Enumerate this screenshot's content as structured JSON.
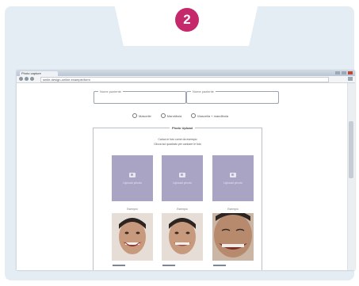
{
  "step": {
    "number": "2"
  },
  "browser": {
    "tab_title": "Photo capture",
    "url": "smile-design-online.example/form"
  },
  "form": {
    "field_left_label": "Nome paziente",
    "field_right_label": "Nome paziente",
    "radios": [
      {
        "label": "Mascelle"
      },
      {
        "label": "Mandibola"
      },
      {
        "label": "Mascella + mandibola"
      }
    ]
  },
  "panel": {
    "legend": "Photo Upload",
    "instruction_1": "Carica le foto come da esempio",
    "instruction_2": "Clicca sul quadrato per caricare le foto"
  },
  "slots": [
    {
      "placeholder": "Upload photo",
      "caption": "Esempio"
    },
    {
      "placeholder": "Upload photo",
      "caption": "Esempio"
    },
    {
      "placeholder": "Upload photo",
      "caption": "Esempio"
    }
  ],
  "colors": {
    "badge": "#c5286b",
    "outer_bg": "#e4edf4",
    "placeholder": "#a9a3c4"
  }
}
